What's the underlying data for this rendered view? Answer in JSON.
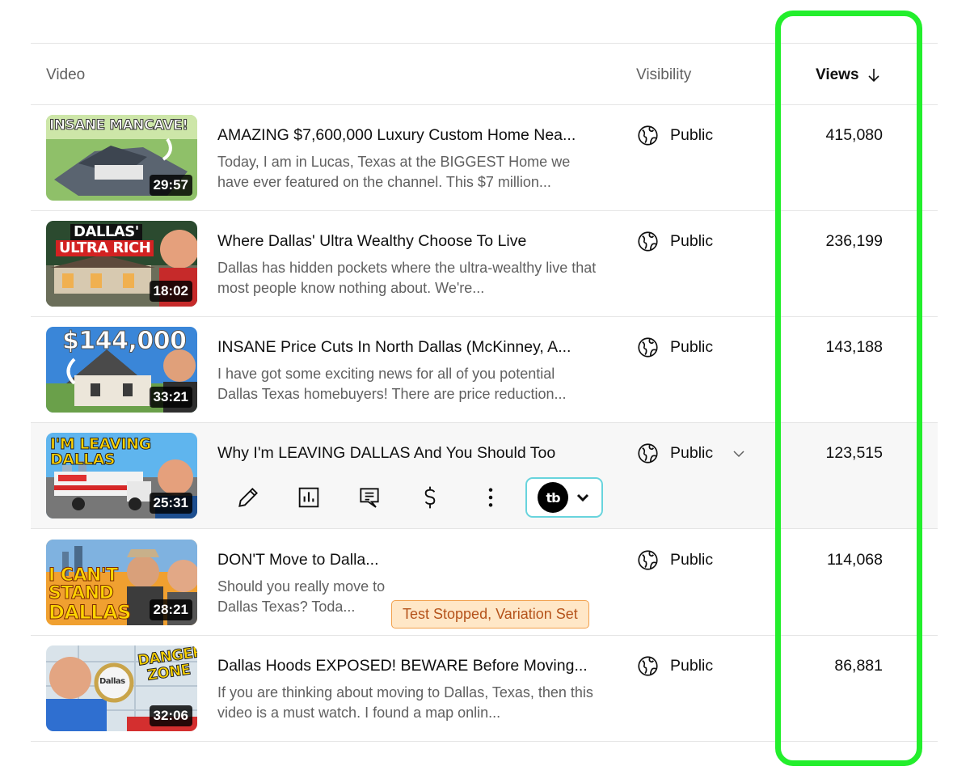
{
  "table": {
    "headers": {
      "video": "Video",
      "visibility": "Visibility",
      "views": "Views"
    },
    "sort_icon": "arrow-down-icon",
    "rows": [
      {
        "thumb_caption": "INSANE MANCAVE!",
        "duration": "29:57",
        "title": "AMAZING $7,600,000 Luxury Custom Home Nea...",
        "description": "Today, I am in Lucas, Texas at the BIGGEST Home we have ever featured on the channel. This $7 million...",
        "visibility": "Public",
        "views": "415,080"
      },
      {
        "thumb_caption": "DALLAS'",
        "thumb_caption2": "ULTRA RICH",
        "duration": "18:02",
        "title": "Where Dallas' Ultra Wealthy Choose To Live",
        "description": "Dallas has hidden pockets where the ultra-wealthy live that most people know nothing about. We're...",
        "visibility": "Public",
        "views": "236,199"
      },
      {
        "thumb_caption": "$144,000",
        "duration": "33:21",
        "title": "INSANE Price Cuts In North Dallas (McKinney, A...",
        "description": "I have got some exciting news for all of you potential Dallas Texas homebuyers! There are price reduction...",
        "visibility": "Public",
        "views": "143,188"
      },
      {
        "thumb_caption": "I'M LEAVING DALLAS",
        "duration": "25:31",
        "title": "Why I'm LEAVING DALLAS And You Should Too",
        "visibility": "Public",
        "views": "123,515",
        "tubebuddy_label": "tb"
      },
      {
        "thumb_caption": "I CAN'T",
        "thumb_caption2": "STAND",
        "thumb_caption3": "DALLAS",
        "duration": "28:21",
        "title": "DON'T Move to Dalla...",
        "description": "Should you really move to Dallas Texas? Toda...",
        "badge": "Test Stopped, Variation Set",
        "visibility": "Public",
        "views": "114,068"
      },
      {
        "thumb_caption": "DANGER",
        "thumb_caption2": "ZONE",
        "thumb_caption3": "Dallas",
        "duration": "32:06",
        "title": "Dallas Hoods EXPOSED! BEWARE Before Moving...",
        "description": "If you are thinking about moving to Dallas, Texas, then this video is a must watch. I found a map onlin...",
        "visibility": "Public",
        "views": "86,881"
      }
    ]
  },
  "colors": {
    "highlight": "#23ee2c",
    "badge_bg": "#ffe7c7",
    "badge_text": "#b5531b",
    "tubebuddy_border": "#68d4dd"
  },
  "icons": {
    "visibility": "globe-icon",
    "edit": "pencil-icon",
    "analytics": "bar-chart-icon",
    "comments": "comment-icon",
    "monetization": "dollar-icon",
    "more": "more-vert-icon",
    "dropdown": "chevron-down-icon"
  }
}
